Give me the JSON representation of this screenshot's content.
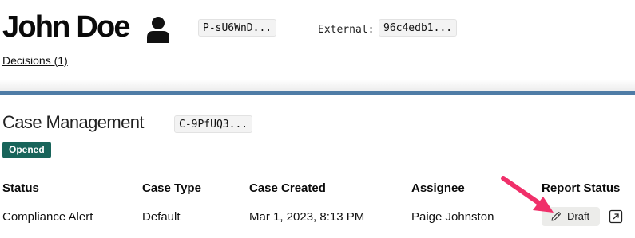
{
  "profile": {
    "name": "John Doe",
    "person_id": "P-sU6WnD...",
    "external_label": "External:",
    "external_id": "96c4edb1...",
    "decisions_link": "Decisions (1)"
  },
  "case": {
    "title": "Case Management",
    "case_id": "C-9PfUQ3...",
    "state_badge": "Opened",
    "columns": [
      "Status",
      "Case Type",
      "Case Created",
      "Assignee",
      "Report Status"
    ],
    "row": {
      "status": "Compliance Alert",
      "case_type": "Default",
      "created": "Mar 1, 2023, 8:13 PM",
      "assignee": "Paige Johnston",
      "report_status": "Draft"
    }
  },
  "colors": {
    "divider": "#4f7ca6",
    "badge": "#18645a",
    "annotation_arrow": "#f0306a"
  },
  "icons": [
    "person-icon",
    "pencil-icon",
    "external-link-icon",
    "annotation-arrow"
  ]
}
